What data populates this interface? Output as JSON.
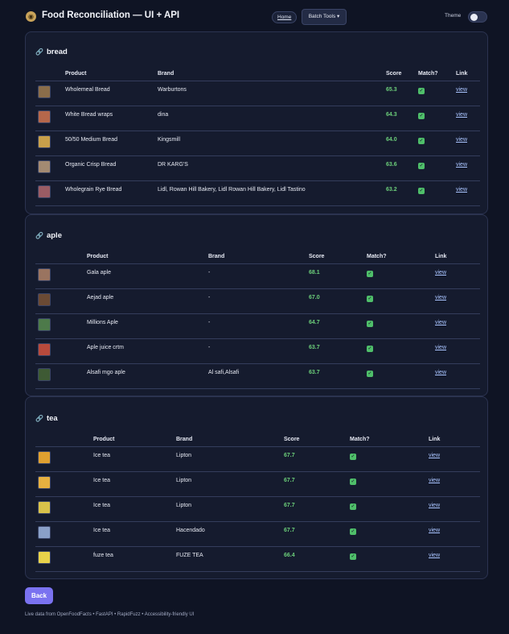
{
  "header": {
    "app_icon": "bread-bowl-icon",
    "title": "Food Reconciliation — UI + API",
    "nav_home": "Home",
    "nav_batch": "Batch Tools ▾",
    "theme_label": "Theme"
  },
  "columns": {
    "product": "Product",
    "brand": "Brand",
    "score": "Score",
    "match": "Match?",
    "link": "Link"
  },
  "sections": [
    {
      "title": "bread",
      "rows": [
        {
          "product": "Wholemeal Bread",
          "brand": "Warburtons",
          "score": "65.3",
          "link": "view",
          "thumb": "#8a6d4a"
        },
        {
          "product": "White Bread wraps",
          "brand": "dina",
          "score": "64.3",
          "link": "view",
          "thumb": "#b5674b"
        },
        {
          "product": "50/50 Medium Bread",
          "brand": "Kingsmill",
          "score": "64.0",
          "link": "view",
          "thumb": "#c8a04a"
        },
        {
          "product": "Organic Crisp Bread",
          "brand": "DR KARG'S",
          "score": "63.6",
          "link": "view",
          "thumb": "#a38a72"
        },
        {
          "product": "Wholegrain Rye Bread",
          "brand": "Lidl, Rowan Hill Bakery, Lidl Rowan Hill Bakery, Lidl Tastino",
          "score": "63.2",
          "link": "view",
          "thumb": "#9a5c64"
        }
      ]
    },
    {
      "title": "aple",
      "rows": [
        {
          "product": "Gala aple",
          "brand": "-",
          "score": "68.1",
          "link": "view",
          "thumb": "#9a7460"
        },
        {
          "product": "Aejad aple",
          "brand": "-",
          "score": "67.0",
          "link": "view",
          "thumb": "#6b4a34"
        },
        {
          "product": "Millions Aple",
          "brand": "-",
          "score": "64.7",
          "link": "view",
          "thumb": "#4d7a4a"
        },
        {
          "product": "Aple juice crtm",
          "brand": "-",
          "score": "63.7",
          "link": "view",
          "thumb": "#b84a3c"
        },
        {
          "product": "Alsafi mgo aple",
          "brand": "Al safi,Alsafi",
          "score": "63.7",
          "link": "view",
          "thumb": "#3e5a34"
        }
      ]
    },
    {
      "title": "tea",
      "rows": [
        {
          "product": "Ice tea",
          "brand": "Lipton",
          "score": "67.7",
          "link": "view",
          "thumb": "#e0a030"
        },
        {
          "product": "Ice tea",
          "brand": "Lipton",
          "score": "67.7",
          "link": "view",
          "thumb": "#e6b040"
        },
        {
          "product": "Ice tea",
          "brand": "Lipton",
          "score": "67.7",
          "link": "view",
          "thumb": "#d9c24a"
        },
        {
          "product": "Ice tea",
          "brand": "Hacendado",
          "score": "67.7",
          "link": "view",
          "thumb": "#8aa0c8"
        },
        {
          "product": "fuze tea",
          "brand": "FUZE TEA",
          "score": "66.4",
          "link": "view",
          "thumb": "#e8d24a"
        }
      ]
    }
  ],
  "back_label": "Back",
  "footer": "Live data from OpenFoodFacts • FastAPI • RapidFuzz • Accessibility-friendly UI",
  "colors": {
    "background": "#0f1424",
    "card": "#151b2e",
    "score": "#6ccf7a",
    "link": "#a9c4ff",
    "back_button": "#7a72f0"
  }
}
